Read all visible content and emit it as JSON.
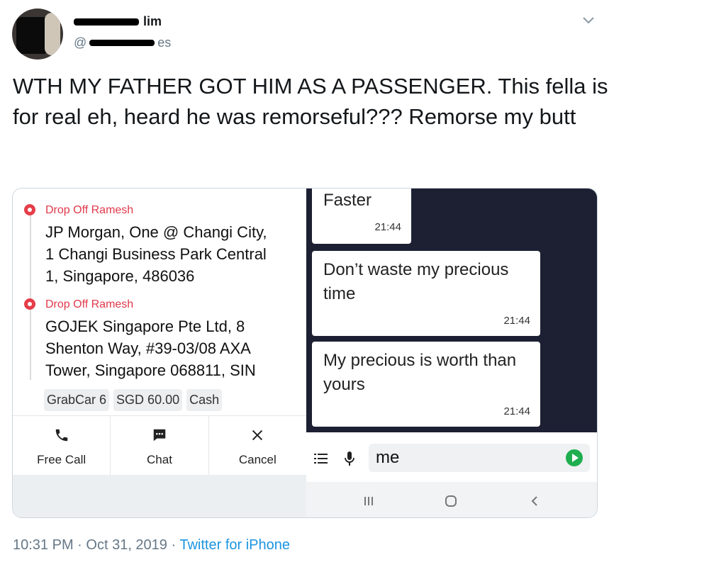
{
  "author": {
    "name_visible": "lim",
    "handle_prefix": "@",
    "handle_visible": "es"
  },
  "tweet": {
    "text": "WTH MY FATHER GOT HIM AS A PASSENGER. This fella is for real eh, heard he was remorseful??? Remorse my butt"
  },
  "screenshot": {
    "drop_offs": [
      {
        "label": "Drop Off Ramesh",
        "address": "JP Morgan, One @ Changi City, 1 Changi Business Park Central 1, Singapore, 486036"
      },
      {
        "label": "Drop Off Ramesh",
        "address": "GOJEK Singapore Pte Ltd, 8 Shenton Way, #39-03/08 AXA Tower, Singapore 068811, SIN"
      }
    ],
    "chips": [
      "GrabCar 6",
      "SGD 60.00",
      "Cash"
    ],
    "actions": [
      {
        "label": "Free Call",
        "icon": "phone-icon"
      },
      {
        "label": "Chat",
        "icon": "chat-icon"
      },
      {
        "label": "Cancel",
        "icon": "close-icon"
      }
    ],
    "messages": [
      {
        "text": "Faster",
        "time": "21:44"
      },
      {
        "text": "Don’t waste my precious time",
        "time": "21:44"
      },
      {
        "text": "My precious is worth than yours",
        "time": "21:44"
      }
    ],
    "input_value": "me",
    "icons": [
      "list-icon",
      "mic-icon",
      "send-icon",
      "recents-icon",
      "home-icon",
      "back-icon"
    ],
    "colors": {
      "accent_red": "#e0394b",
      "chat_bg": "#1d2033",
      "send_green": "#1fae4f"
    }
  },
  "meta": {
    "time": "10:31 PM",
    "separator": "·",
    "date": "Oct 31, 2019",
    "source": "Twitter for iPhone"
  }
}
